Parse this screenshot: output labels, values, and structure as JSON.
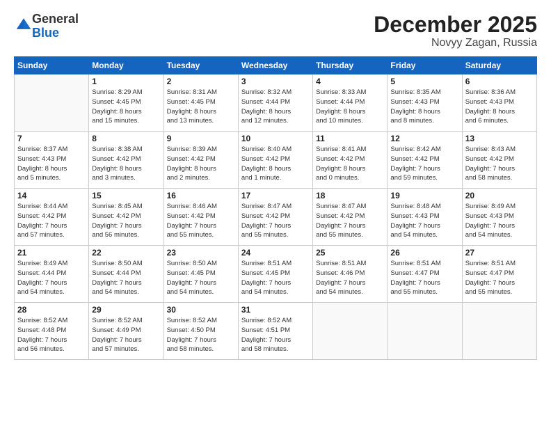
{
  "logo": {
    "general": "General",
    "blue": "Blue"
  },
  "header": {
    "month": "December 2025",
    "location": "Novyy Zagan, Russia"
  },
  "weekdays": [
    "Sunday",
    "Monday",
    "Tuesday",
    "Wednesday",
    "Thursday",
    "Friday",
    "Saturday"
  ],
  "weeks": [
    [
      {
        "day": "",
        "info": ""
      },
      {
        "day": "1",
        "info": "Sunrise: 8:29 AM\nSunset: 4:45 PM\nDaylight: 8 hours\nand 15 minutes."
      },
      {
        "day": "2",
        "info": "Sunrise: 8:31 AM\nSunset: 4:45 PM\nDaylight: 8 hours\nand 13 minutes."
      },
      {
        "day": "3",
        "info": "Sunrise: 8:32 AM\nSunset: 4:44 PM\nDaylight: 8 hours\nand 12 minutes."
      },
      {
        "day": "4",
        "info": "Sunrise: 8:33 AM\nSunset: 4:44 PM\nDaylight: 8 hours\nand 10 minutes."
      },
      {
        "day": "5",
        "info": "Sunrise: 8:35 AM\nSunset: 4:43 PM\nDaylight: 8 hours\nand 8 minutes."
      },
      {
        "day": "6",
        "info": "Sunrise: 8:36 AM\nSunset: 4:43 PM\nDaylight: 8 hours\nand 6 minutes."
      }
    ],
    [
      {
        "day": "7",
        "info": "Sunrise: 8:37 AM\nSunset: 4:43 PM\nDaylight: 8 hours\nand 5 minutes."
      },
      {
        "day": "8",
        "info": "Sunrise: 8:38 AM\nSunset: 4:42 PM\nDaylight: 8 hours\nand 3 minutes."
      },
      {
        "day": "9",
        "info": "Sunrise: 8:39 AM\nSunset: 4:42 PM\nDaylight: 8 hours\nand 2 minutes."
      },
      {
        "day": "10",
        "info": "Sunrise: 8:40 AM\nSunset: 4:42 PM\nDaylight: 8 hours\nand 1 minute."
      },
      {
        "day": "11",
        "info": "Sunrise: 8:41 AM\nSunset: 4:42 PM\nDaylight: 8 hours\nand 0 minutes."
      },
      {
        "day": "12",
        "info": "Sunrise: 8:42 AM\nSunset: 4:42 PM\nDaylight: 7 hours\nand 59 minutes."
      },
      {
        "day": "13",
        "info": "Sunrise: 8:43 AM\nSunset: 4:42 PM\nDaylight: 7 hours\nand 58 minutes."
      }
    ],
    [
      {
        "day": "14",
        "info": "Sunrise: 8:44 AM\nSunset: 4:42 PM\nDaylight: 7 hours\nand 57 minutes."
      },
      {
        "day": "15",
        "info": "Sunrise: 8:45 AM\nSunset: 4:42 PM\nDaylight: 7 hours\nand 56 minutes."
      },
      {
        "day": "16",
        "info": "Sunrise: 8:46 AM\nSunset: 4:42 PM\nDaylight: 7 hours\nand 55 minutes."
      },
      {
        "day": "17",
        "info": "Sunrise: 8:47 AM\nSunset: 4:42 PM\nDaylight: 7 hours\nand 55 minutes."
      },
      {
        "day": "18",
        "info": "Sunrise: 8:47 AM\nSunset: 4:42 PM\nDaylight: 7 hours\nand 55 minutes."
      },
      {
        "day": "19",
        "info": "Sunrise: 8:48 AM\nSunset: 4:43 PM\nDaylight: 7 hours\nand 54 minutes."
      },
      {
        "day": "20",
        "info": "Sunrise: 8:49 AM\nSunset: 4:43 PM\nDaylight: 7 hours\nand 54 minutes."
      }
    ],
    [
      {
        "day": "21",
        "info": "Sunrise: 8:49 AM\nSunset: 4:44 PM\nDaylight: 7 hours\nand 54 minutes."
      },
      {
        "day": "22",
        "info": "Sunrise: 8:50 AM\nSunset: 4:44 PM\nDaylight: 7 hours\nand 54 minutes."
      },
      {
        "day": "23",
        "info": "Sunrise: 8:50 AM\nSunset: 4:45 PM\nDaylight: 7 hours\nand 54 minutes."
      },
      {
        "day": "24",
        "info": "Sunrise: 8:51 AM\nSunset: 4:45 PM\nDaylight: 7 hours\nand 54 minutes."
      },
      {
        "day": "25",
        "info": "Sunrise: 8:51 AM\nSunset: 4:46 PM\nDaylight: 7 hours\nand 54 minutes."
      },
      {
        "day": "26",
        "info": "Sunrise: 8:51 AM\nSunset: 4:47 PM\nDaylight: 7 hours\nand 55 minutes."
      },
      {
        "day": "27",
        "info": "Sunrise: 8:51 AM\nSunset: 4:47 PM\nDaylight: 7 hours\nand 55 minutes."
      }
    ],
    [
      {
        "day": "28",
        "info": "Sunrise: 8:52 AM\nSunset: 4:48 PM\nDaylight: 7 hours\nand 56 minutes."
      },
      {
        "day": "29",
        "info": "Sunrise: 8:52 AM\nSunset: 4:49 PM\nDaylight: 7 hours\nand 57 minutes."
      },
      {
        "day": "30",
        "info": "Sunrise: 8:52 AM\nSunset: 4:50 PM\nDaylight: 7 hours\nand 58 minutes."
      },
      {
        "day": "31",
        "info": "Sunrise: 8:52 AM\nSunset: 4:51 PM\nDaylight: 7 hours\nand 58 minutes."
      },
      {
        "day": "",
        "info": ""
      },
      {
        "day": "",
        "info": ""
      },
      {
        "day": "",
        "info": ""
      }
    ]
  ]
}
